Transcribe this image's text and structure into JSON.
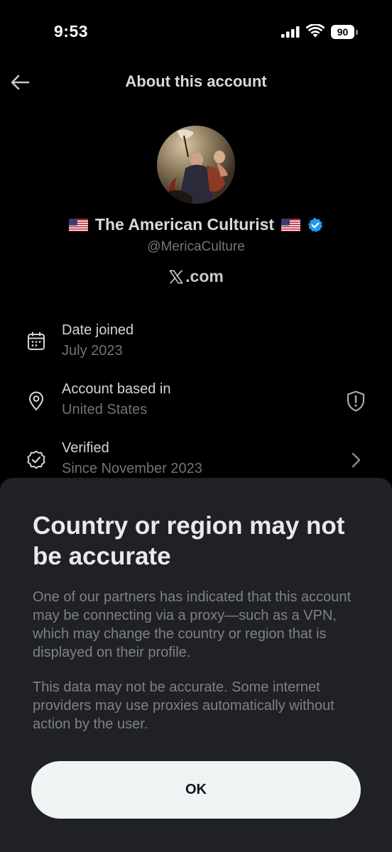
{
  "status_bar": {
    "time": "9:53",
    "battery_level": "90"
  },
  "header": {
    "title": "About this account",
    "back_icon": "arrow-left-icon"
  },
  "profile": {
    "display_name": "The American Culturist",
    "handle": "@MericaCulture",
    "site": ".com",
    "verified": true,
    "avatar_icon": "profile-painting-avatar",
    "flag_icon": "us-flag-icon",
    "colors": {
      "verified_badge": "#1d9bf0"
    }
  },
  "info": [
    {
      "icon": "calendar-icon",
      "label": "Date joined",
      "value": "July 2023"
    },
    {
      "icon": "location-pin-icon",
      "label": "Account based in",
      "value": "United States",
      "trailing_icon": "shield-alert-icon"
    },
    {
      "icon": "verified-check-icon",
      "label": "Verified",
      "value": "Since November 2023",
      "trailing_icon": "chevron-right-icon"
    }
  ],
  "sheet": {
    "title": "Country or region may not be accurate",
    "paragraph1": "One of our partners has indicated that this account may be connecting via a proxy—such as a VPN, which may change the country or region that is displayed on their profile.",
    "paragraph2": "This data may not be accurate. Some internet providers may use proxies automatically without action by the user.",
    "ok_label": "OK"
  }
}
